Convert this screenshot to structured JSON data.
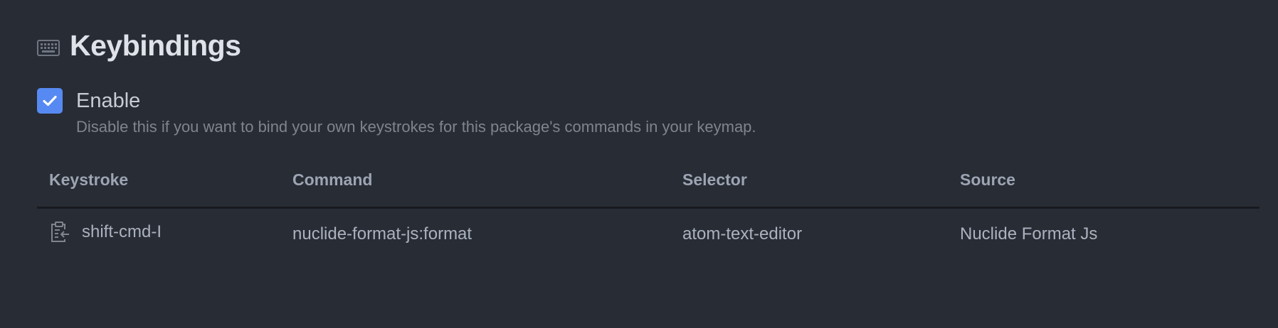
{
  "section": {
    "title": "Keybindings",
    "icon": "keyboard-icon"
  },
  "enable": {
    "checked": true,
    "label": "Enable",
    "description": "Disable this if you want to bind your own keystrokes for this package's commands in your keymap."
  },
  "table": {
    "headers": [
      "Keystroke",
      "Command",
      "Selector",
      "Source"
    ],
    "rows": [
      {
        "keystroke": "shift-cmd-I",
        "command": "nuclide-format-js:format",
        "selector": "atom-text-editor",
        "source": "Nuclide Format Js",
        "icon": "copy-keybinding-icon"
      }
    ]
  },
  "colors": {
    "background": "#282c34",
    "accent": "#568af2",
    "header_text": "#9da5b4",
    "body_text": "#abb2bf"
  }
}
